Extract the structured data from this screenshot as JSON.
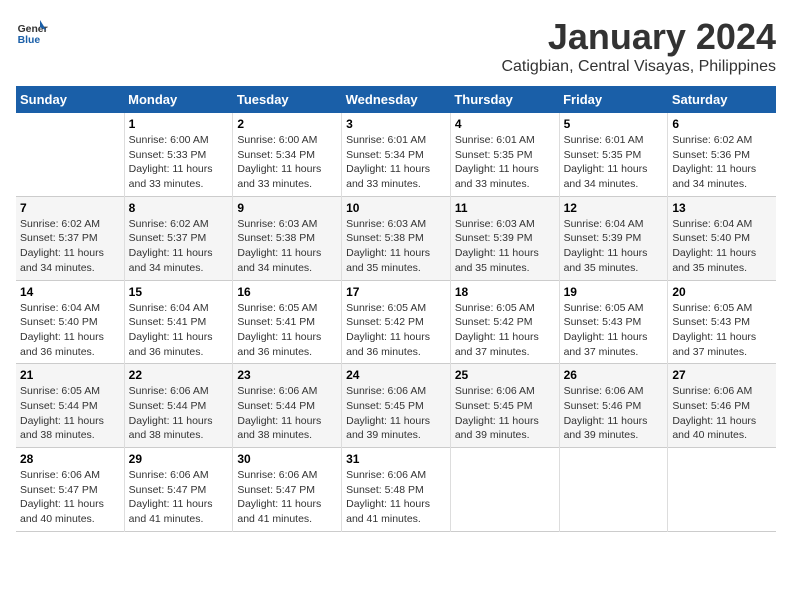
{
  "header": {
    "logo_line1": "General",
    "logo_line2": "Blue",
    "title": "January 2024",
    "subtitle": "Catigbian, Central Visayas, Philippines"
  },
  "weekdays": [
    "Sunday",
    "Monday",
    "Tuesday",
    "Wednesday",
    "Thursday",
    "Friday",
    "Saturday"
  ],
  "weeks": [
    [
      {
        "day": "",
        "text": ""
      },
      {
        "day": "1",
        "text": "Sunrise: 6:00 AM\nSunset: 5:33 PM\nDaylight: 11 hours\nand 33 minutes."
      },
      {
        "day": "2",
        "text": "Sunrise: 6:00 AM\nSunset: 5:34 PM\nDaylight: 11 hours\nand 33 minutes."
      },
      {
        "day": "3",
        "text": "Sunrise: 6:01 AM\nSunset: 5:34 PM\nDaylight: 11 hours\nand 33 minutes."
      },
      {
        "day": "4",
        "text": "Sunrise: 6:01 AM\nSunset: 5:35 PM\nDaylight: 11 hours\nand 33 minutes."
      },
      {
        "day": "5",
        "text": "Sunrise: 6:01 AM\nSunset: 5:35 PM\nDaylight: 11 hours\nand 34 minutes."
      },
      {
        "day": "6",
        "text": "Sunrise: 6:02 AM\nSunset: 5:36 PM\nDaylight: 11 hours\nand 34 minutes."
      }
    ],
    [
      {
        "day": "7",
        "text": "Sunrise: 6:02 AM\nSunset: 5:37 PM\nDaylight: 11 hours\nand 34 minutes."
      },
      {
        "day": "8",
        "text": "Sunrise: 6:02 AM\nSunset: 5:37 PM\nDaylight: 11 hours\nand 34 minutes."
      },
      {
        "day": "9",
        "text": "Sunrise: 6:03 AM\nSunset: 5:38 PM\nDaylight: 11 hours\nand 34 minutes."
      },
      {
        "day": "10",
        "text": "Sunrise: 6:03 AM\nSunset: 5:38 PM\nDaylight: 11 hours\nand 35 minutes."
      },
      {
        "day": "11",
        "text": "Sunrise: 6:03 AM\nSunset: 5:39 PM\nDaylight: 11 hours\nand 35 minutes."
      },
      {
        "day": "12",
        "text": "Sunrise: 6:04 AM\nSunset: 5:39 PM\nDaylight: 11 hours\nand 35 minutes."
      },
      {
        "day": "13",
        "text": "Sunrise: 6:04 AM\nSunset: 5:40 PM\nDaylight: 11 hours\nand 35 minutes."
      }
    ],
    [
      {
        "day": "14",
        "text": "Sunrise: 6:04 AM\nSunset: 5:40 PM\nDaylight: 11 hours\nand 36 minutes."
      },
      {
        "day": "15",
        "text": "Sunrise: 6:04 AM\nSunset: 5:41 PM\nDaylight: 11 hours\nand 36 minutes."
      },
      {
        "day": "16",
        "text": "Sunrise: 6:05 AM\nSunset: 5:41 PM\nDaylight: 11 hours\nand 36 minutes."
      },
      {
        "day": "17",
        "text": "Sunrise: 6:05 AM\nSunset: 5:42 PM\nDaylight: 11 hours\nand 36 minutes."
      },
      {
        "day": "18",
        "text": "Sunrise: 6:05 AM\nSunset: 5:42 PM\nDaylight: 11 hours\nand 37 minutes."
      },
      {
        "day": "19",
        "text": "Sunrise: 6:05 AM\nSunset: 5:43 PM\nDaylight: 11 hours\nand 37 minutes."
      },
      {
        "day": "20",
        "text": "Sunrise: 6:05 AM\nSunset: 5:43 PM\nDaylight: 11 hours\nand 37 minutes."
      }
    ],
    [
      {
        "day": "21",
        "text": "Sunrise: 6:05 AM\nSunset: 5:44 PM\nDaylight: 11 hours\nand 38 minutes."
      },
      {
        "day": "22",
        "text": "Sunrise: 6:06 AM\nSunset: 5:44 PM\nDaylight: 11 hours\nand 38 minutes."
      },
      {
        "day": "23",
        "text": "Sunrise: 6:06 AM\nSunset: 5:44 PM\nDaylight: 11 hours\nand 38 minutes."
      },
      {
        "day": "24",
        "text": "Sunrise: 6:06 AM\nSunset: 5:45 PM\nDaylight: 11 hours\nand 39 minutes."
      },
      {
        "day": "25",
        "text": "Sunrise: 6:06 AM\nSunset: 5:45 PM\nDaylight: 11 hours\nand 39 minutes."
      },
      {
        "day": "26",
        "text": "Sunrise: 6:06 AM\nSunset: 5:46 PM\nDaylight: 11 hours\nand 39 minutes."
      },
      {
        "day": "27",
        "text": "Sunrise: 6:06 AM\nSunset: 5:46 PM\nDaylight: 11 hours\nand 40 minutes."
      }
    ],
    [
      {
        "day": "28",
        "text": "Sunrise: 6:06 AM\nSunset: 5:47 PM\nDaylight: 11 hours\nand 40 minutes."
      },
      {
        "day": "29",
        "text": "Sunrise: 6:06 AM\nSunset: 5:47 PM\nDaylight: 11 hours\nand 41 minutes."
      },
      {
        "day": "30",
        "text": "Sunrise: 6:06 AM\nSunset: 5:47 PM\nDaylight: 11 hours\nand 41 minutes."
      },
      {
        "day": "31",
        "text": "Sunrise: 6:06 AM\nSunset: 5:48 PM\nDaylight: 11 hours\nand 41 minutes."
      },
      {
        "day": "",
        "text": ""
      },
      {
        "day": "",
        "text": ""
      },
      {
        "day": "",
        "text": ""
      }
    ]
  ]
}
